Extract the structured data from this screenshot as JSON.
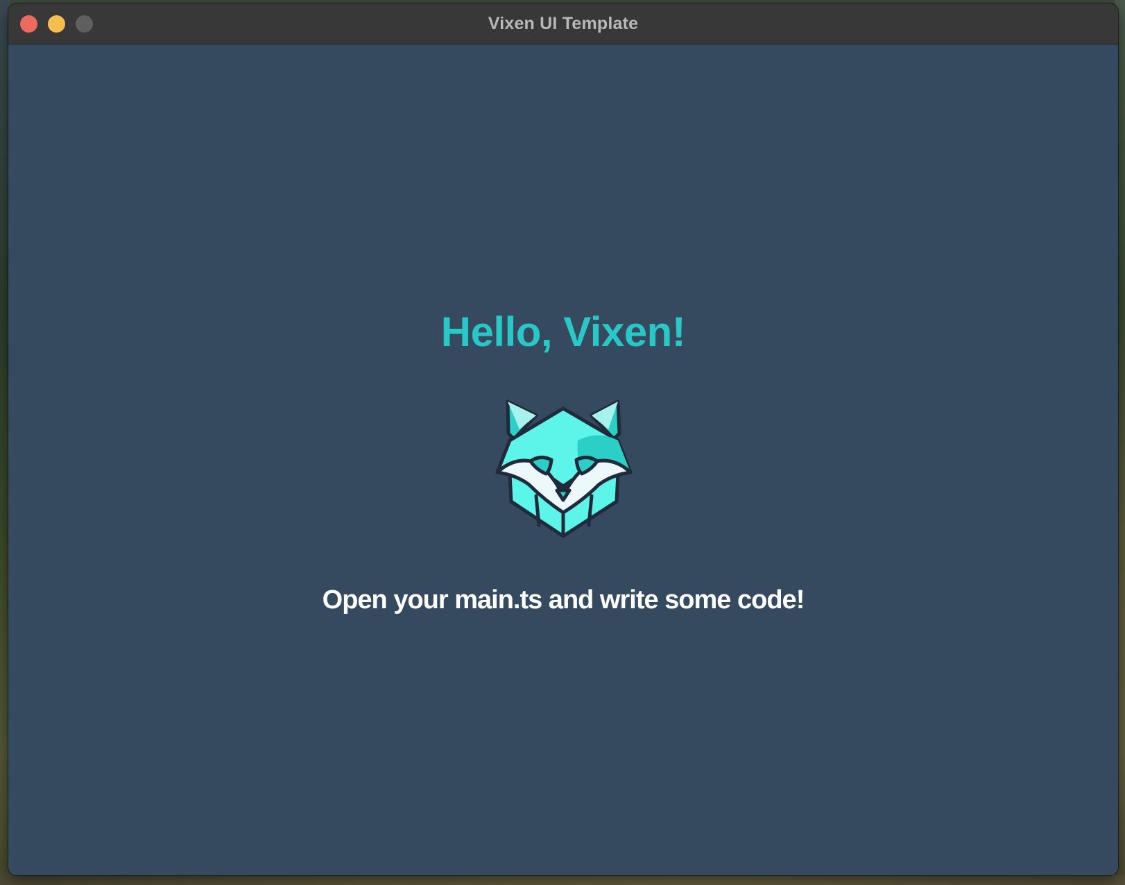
{
  "window": {
    "title": "Vixen UI Template"
  },
  "traffic_lights": {
    "close_color": "#ec6a5e",
    "minimize_color": "#f4bf4f",
    "zoom_color": "#5f5f5f"
  },
  "main": {
    "heading": "Hello, Vixen!",
    "logo_icon": "vixen-fox-logo-icon",
    "subtitle": "Open your main.ts and write some code!"
  },
  "colors": {
    "background": "#354a5f",
    "accent": "#29c7c6",
    "titlebar": "#383838",
    "text": "#ffffff"
  }
}
